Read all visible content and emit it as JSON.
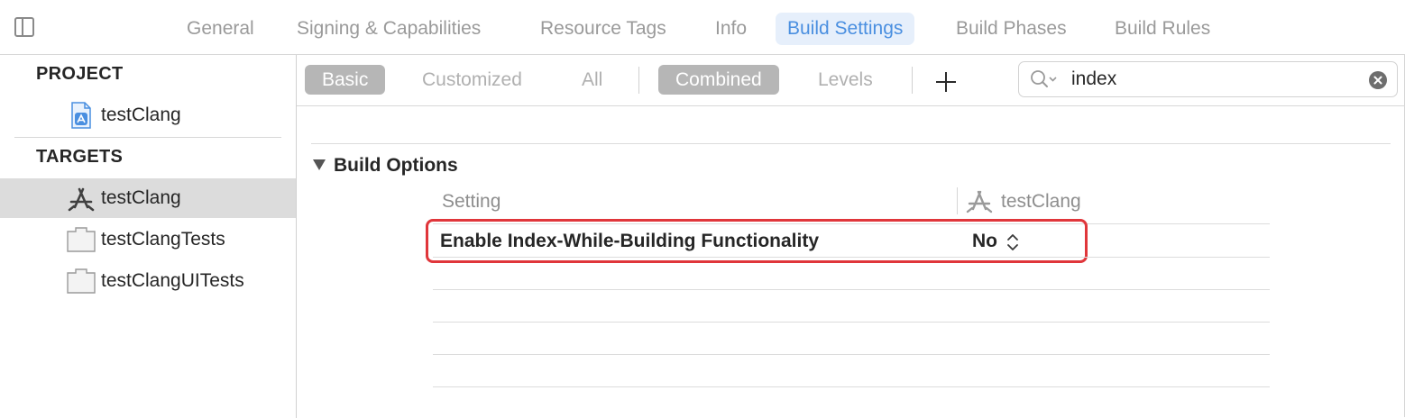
{
  "tabs": [
    {
      "label": "General",
      "active": false
    },
    {
      "label": "Signing & Capabilities",
      "active": false
    },
    {
      "label": "Resource Tags",
      "active": false
    },
    {
      "label": "Info",
      "active": false
    },
    {
      "label": "Build Settings",
      "active": true
    },
    {
      "label": "Build Phases",
      "active": false
    },
    {
      "label": "Build Rules",
      "active": false
    }
  ],
  "sidebar": {
    "project_header": "PROJECT",
    "project_item": {
      "label": "testClang",
      "icon": "project-file-icon"
    },
    "targets_header": "TARGETS",
    "targets": [
      {
        "label": "testClang",
        "icon": "app-target-icon",
        "selected": true
      },
      {
        "label": "testClangTests",
        "icon": "bundle-icon",
        "selected": false
      },
      {
        "label": "testClangUITests",
        "icon": "bundle-icon",
        "selected": false
      }
    ]
  },
  "filter": {
    "basic": "Basic",
    "customized": "Customized",
    "all": "All",
    "combined": "Combined",
    "levels": "Levels",
    "search_value": "index"
  },
  "section": {
    "title": "Build Options",
    "col_setting": "Setting",
    "col_target": "testClang",
    "row": {
      "name": "Enable Index-While-Building Functionality",
      "value": "No"
    }
  },
  "colors": {
    "accent": "#4a8fe0",
    "highlight_border": "#e0363b",
    "selected_row": "#dcdcdc",
    "pill_on": "#b6b6b6"
  }
}
